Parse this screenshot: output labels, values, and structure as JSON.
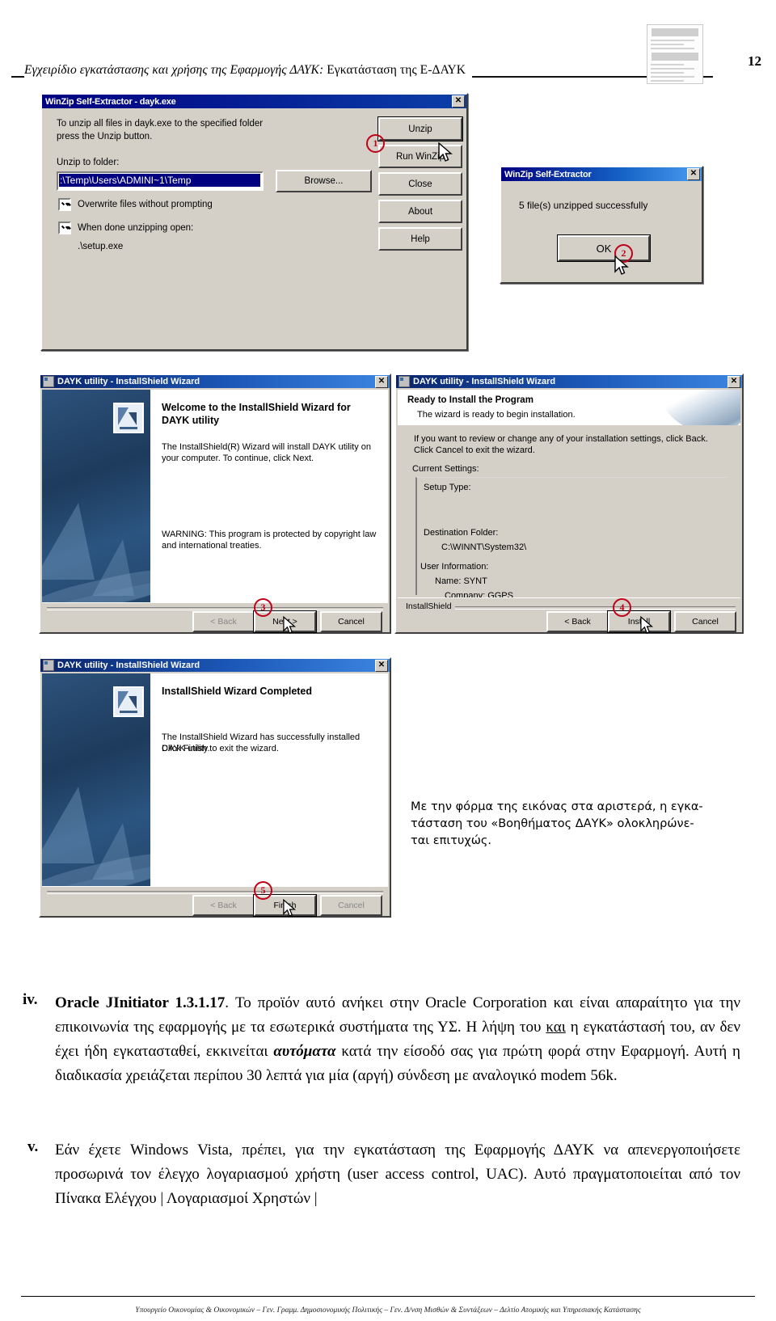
{
  "header": {
    "title_italic": "Εγχειρίδιο εγκατάστασης και χρήσης της Εφαρμογής ΔΑΥΚ:",
    "title_plain": " Εγκατάσταση της Ε-ΔΑΥΚ",
    "page_number": "12"
  },
  "winzip_extractor": {
    "title": "WinZip Self-Extractor - dayk.exe",
    "close_glyph": "✕",
    "instruction": "To unzip all files in dayk.exe to the specified folder press the Unzip button.",
    "instruction_line1": "To unzip all files in dayk.exe to the specified folder",
    "instruction_line2": "press the Unzip button.",
    "folder_label": "Unzip to folder:",
    "folder_value": ":\\Temp\\Users\\ADMINI~1\\Temp",
    "browse_label": "Browse...",
    "checkbox_overwrite": "Overwrite files without prompting",
    "checkbox_when_done": "When done unzipping open:",
    "open_target": ".\\setup.exe",
    "buttons": {
      "unzip": "Unzip",
      "run_winzip": "Run WinZip",
      "close": "Close",
      "about": "About",
      "help": "Help"
    },
    "marker": "1"
  },
  "winzip_done": {
    "title": "WinZip Self-Extractor",
    "close_glyph": "✕",
    "message": "5 file(s) unzipped successfully",
    "ok_label": "OK",
    "marker": "2"
  },
  "wizard_welcome": {
    "title": "DAYK utility - InstallShield Wizard",
    "close_glyph": "✕",
    "heading": "Welcome to the InstallShield Wizard for DAYK utility",
    "body": "The InstallShield(R) Wizard will install DAYK utility on your computer. To continue, click Next.",
    "warning": "WARNING: This program is protected by copyright law and international treaties.",
    "back_label": "< Back",
    "next_label": "Next >",
    "cancel_label": "Cancel",
    "marker": "3"
  },
  "wizard_ready": {
    "title": "DAYK utility - InstallShield Wizard",
    "close_glyph": "✕",
    "heading": "Ready to Install the Program",
    "subheading": "The wizard is ready to begin installation.",
    "body": "If you want to review or change any of your installation settings, click Back. Click Cancel to exit the wizard.",
    "current_settings_label": "Current Settings:",
    "setup_type_label": "Setup Type:",
    "destination_label": "Destination Folder:",
    "destination_value": "C:\\WINNT\\System32\\",
    "user_info_label": "User Information:",
    "user_name": "Name: SYNT",
    "user_company": "Company: GGPS",
    "brand": "InstallShield",
    "back_label": "< Back",
    "install_label": "Install",
    "cancel_label": "Cancel",
    "marker": "4"
  },
  "wizard_completed": {
    "title": "DAYK utility - InstallShield Wizard",
    "close_glyph": "✕",
    "heading": "InstallShield Wizard Completed",
    "body_line1": "The InstallShield Wizard has successfully installed DAYK utility.",
    "body_line2": "Click Finish to exit the wizard.",
    "back_label": "< Back",
    "finish_label": "Finish",
    "cancel_label": "Cancel",
    "marker": "5"
  },
  "caption": {
    "line1": "Με την φόρμα της εικόνας στα αριστερά, η εγκα-",
    "line2": "τάσταση του «Βοηθήματος ΔΑΥΚ» ολοκληρώνε-",
    "line3": "ται επιτυχώς."
  },
  "paragraphs": [
    {
      "marker": "iv.",
      "lead": "Oracle JInitiator 1.3.1.17",
      "text_1": ". Το προϊόν αυτό ανήκει στην Oracle Corporation και είναι απαραίτητο για την επικοινωνία της εφαρμογής με τα εσωτερικά συστήματα της ΥΣ. Η λήψη του ",
      "underlined": "και",
      "text_2": " η εγκατάστασή του, αν δεν έχει ήδη εγκατασταθεί, εκκινείται ",
      "bold_italic": "αυτόματα",
      "text_3": " κατά την είσοδό σας για πρώτη φορά στην Εφαρμογή. Αυτή η διαδικασία χρειάζεται περίπου 30 λεπτά για μία (αργή) σύνδεση με αναλογικό modem 56k."
    },
    {
      "marker": "v.",
      "text_1": "Εάν έχετε Windows Vista, πρέπει, για την εγκατάσταση της Εφαρμογής ΔΑΥΚ να απενεργοποιήσετε προσωρινά τον έλεγχο λογαριασμού χρήστη (user access control, UAC). Αυτό πραγματοποιείται από τον Πίνακα Ελέγχου | Λογαριασμοί Χρηστών |"
    }
  ],
  "footer": {
    "text": "Υπουργείο Οικονομίας & Οικονομικών – Γεν. Γραμμ. Δημοσιονομικής Πολιτικής – Γεν. Δ/νση Μισθών & Συντάξεων – Δελτίο Ατομικής και Υπηρεσιακής Κατάστασης"
  },
  "colors": {
    "marker_red": "#c00018",
    "title_blue": "#000080",
    "dialog_face": "#d4d0c8"
  }
}
